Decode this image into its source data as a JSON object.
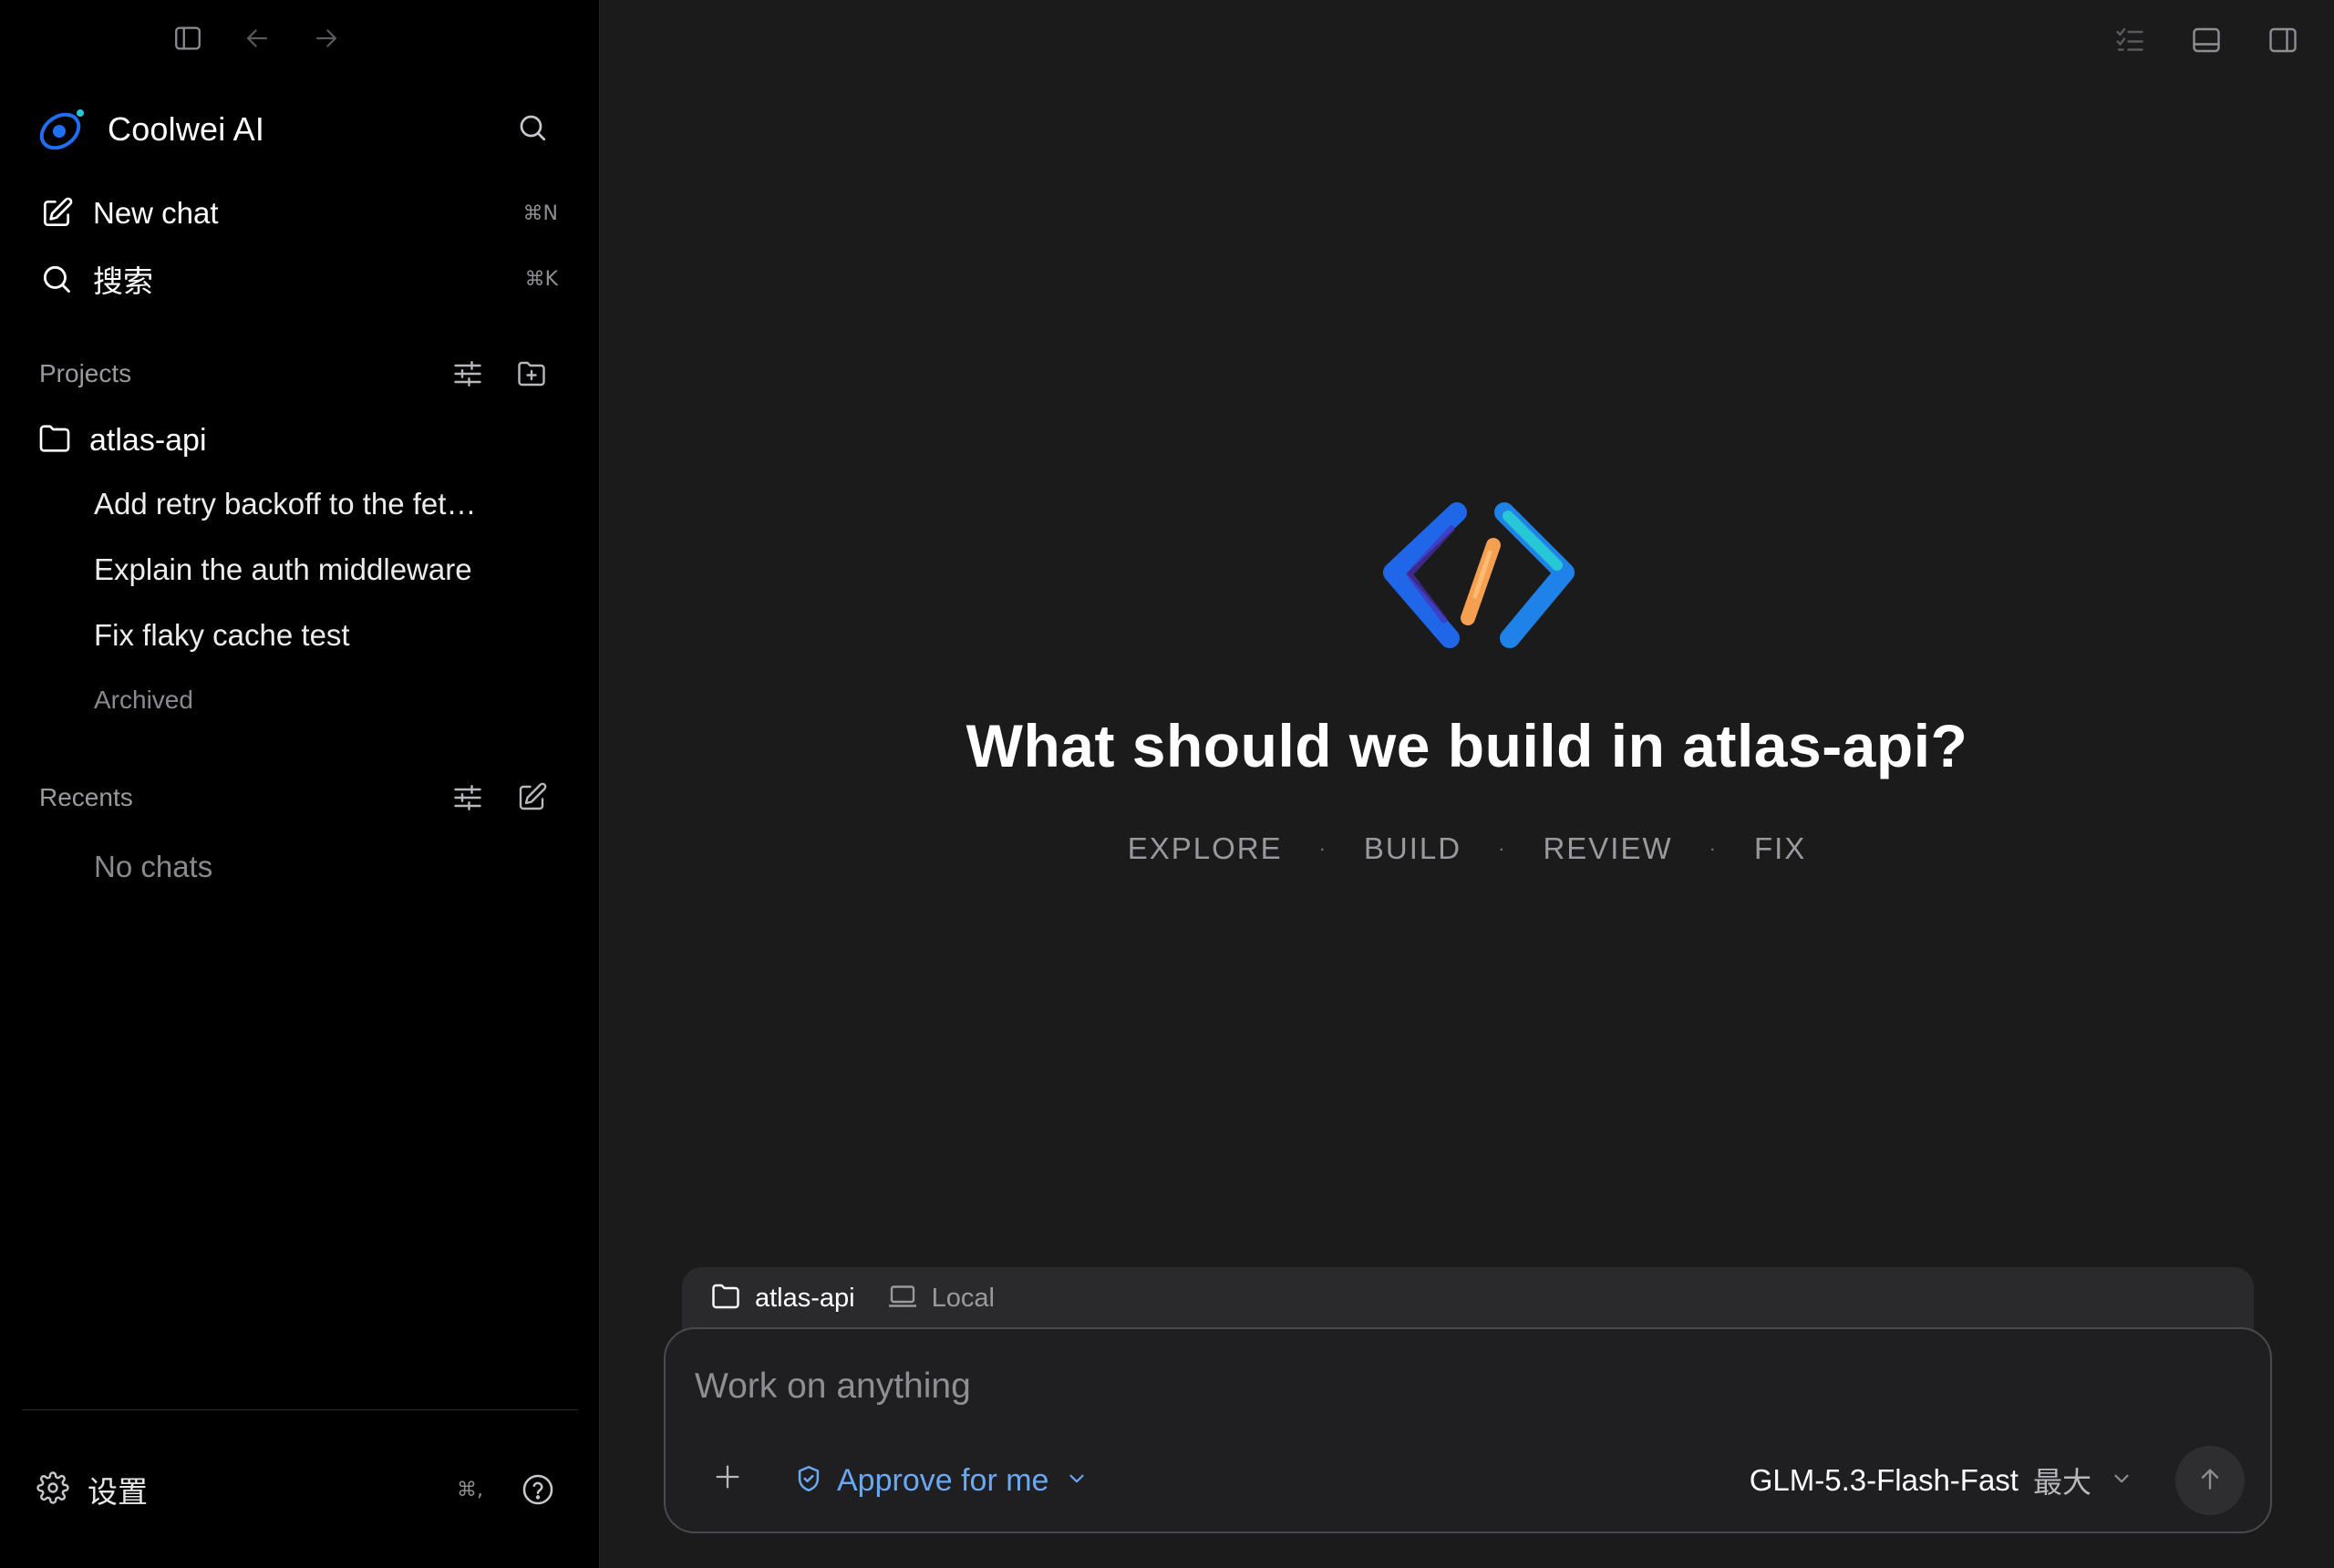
{
  "app": {
    "name": "Coolwei AI"
  },
  "topnav": {
    "toggle_sidebar_icon": "sidebar-icon",
    "back_icon": "arrow-left-icon",
    "forward_icon": "arrow-right-icon"
  },
  "menu": {
    "new_chat": {
      "label": "New chat",
      "shortcut": "⌘N"
    },
    "search": {
      "label": "搜索",
      "shortcut": "⌘K"
    }
  },
  "projects": {
    "header": "Projects",
    "items": [
      {
        "name": "atlas-api",
        "chats": [
          "Add retry backoff to the fet…",
          "Explain the auth middleware",
          "Fix flaky cache test"
        ],
        "archived_label": "Archived"
      }
    ]
  },
  "recents": {
    "header": "Recents",
    "empty_label": "No chats"
  },
  "settings": {
    "label": "设置",
    "shortcut": "⌘,"
  },
  "main": {
    "title": "What should we build in atlas-api?",
    "tags": [
      "EXPLORE",
      "BUILD",
      "REVIEW",
      "FIX"
    ],
    "tag_separator": "·"
  },
  "composer": {
    "context": {
      "project": "atlas-api",
      "environment": "Local"
    },
    "placeholder": "Work on anything",
    "approval_mode": "Approve for me",
    "model": "GLM-5.3-Flash-Fast",
    "effort": "最大"
  },
  "colors": {
    "sidebar_bg": "#000000",
    "main_bg": "#1b1b1c",
    "accent_blue": "#6aa8f2",
    "logo_blue": "#1f6ff2",
    "logo_orange": "#f5a050",
    "logo_cyan": "#28c7d6"
  }
}
